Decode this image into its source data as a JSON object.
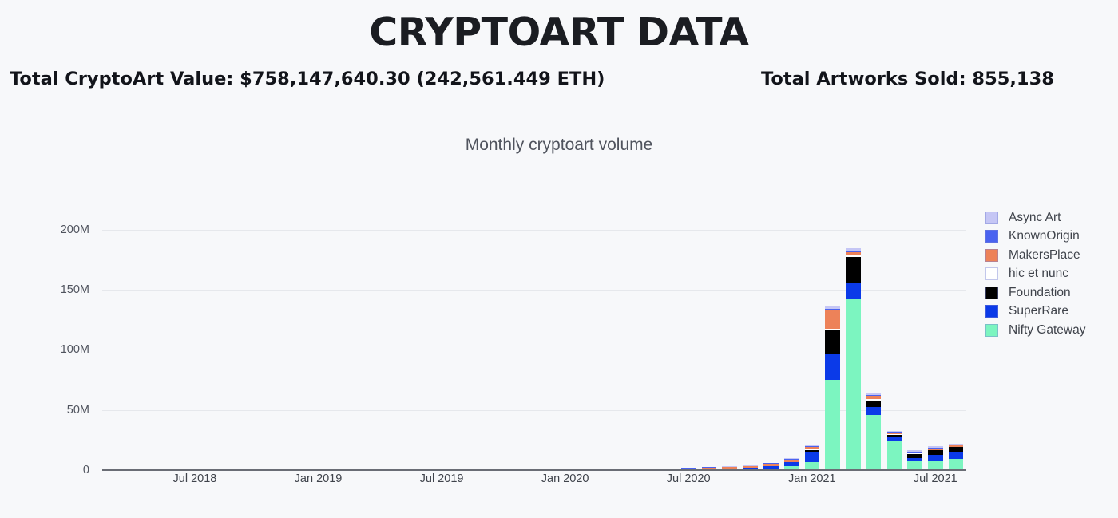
{
  "header": {
    "title": "CRYPTOART DATA",
    "total_value_label": "Total CryptoArt Value: $758,147,640.30 (242,561.449 ETH)",
    "total_sold_label": "Total Artworks Sold: 855,138"
  },
  "chart_data": {
    "type": "bar",
    "stacked": true,
    "title": "Monthly cryptoart volume",
    "xlabel": "",
    "ylabel": "",
    "ylim": [
      0,
      215000000
    ],
    "grid": true,
    "legend_position": "right",
    "ytick_labels": [
      "0",
      "50M",
      "100M",
      "150M",
      "200M"
    ],
    "ytick_values": [
      0,
      50000000,
      100000000,
      150000000,
      200000000
    ],
    "xtick_labels": [
      "Jul 2018",
      "Jan 2019",
      "Jul 2019",
      "Jan 2020",
      "Jul 2020",
      "Jan 2021",
      "Jul 2021"
    ],
    "xtick_indices": [
      4,
      10,
      16,
      22,
      28,
      34,
      40
    ],
    "categories": [
      "Mar 2018",
      "Apr 2018",
      "May 2018",
      "Jun 2018",
      "Jul 2018",
      "Aug 2018",
      "Sep 2018",
      "Oct 2018",
      "Nov 2018",
      "Dec 2018",
      "Jan 2019",
      "Feb 2019",
      "Mar 2019",
      "Apr 2019",
      "May 2019",
      "Jun 2019",
      "Jul 2019",
      "Aug 2019",
      "Sep 2019",
      "Oct 2019",
      "Nov 2019",
      "Dec 2019",
      "Jan 2020",
      "Feb 2020",
      "Mar 2020",
      "Apr 2020",
      "May 2020",
      "Jun 2020",
      "Jul 2020",
      "Aug 2020",
      "Sep 2020",
      "Oct 2020",
      "Nov 2020",
      "Dec 2020",
      "Jan 2021",
      "Feb 2021",
      "Mar 2021",
      "Apr 2021",
      "May 2021",
      "Jun 2021",
      "Jul 2021",
      "Aug 2021"
    ],
    "series": [
      {
        "name": "Nifty Gateway",
        "color": "#7cf5c0",
        "values": [
          0,
          0,
          0,
          0,
          0,
          0,
          0,
          0,
          0,
          0,
          0,
          0,
          0,
          0,
          0,
          0,
          0,
          0,
          0,
          0,
          0,
          0,
          0,
          0,
          0,
          0,
          0,
          0,
          0,
          0,
          0,
          0,
          900000,
          3600000,
          6800000,
          75000000,
          143000000,
          46000000,
          24000000,
          7000000,
          8000000,
          9000000
        ]
      },
      {
        "name": "SuperRare",
        "color": "#0b3ae8",
        "values": [
          180000,
          160000,
          150000,
          170000,
          200000,
          180000,
          160000,
          150000,
          170000,
          200000,
          220000,
          200000,
          260000,
          250000,
          230000,
          260000,
          300000,
          280000,
          260000,
          300000,
          330000,
          350000,
          420000,
          450000,
          380000,
          420000,
          500000,
          700000,
          900000,
          1200000,
          1400000,
          1900000,
          2600000,
          3200000,
          8500000,
          22000000,
          13000000,
          6500000,
          3500000,
          3000000,
          4500000,
          6500000
        ]
      },
      {
        "name": "Foundation",
        "color": "#000000",
        "values": [
          0,
          0,
          0,
          0,
          0,
          0,
          0,
          0,
          0,
          0,
          0,
          0,
          0,
          0,
          0,
          0,
          0,
          0,
          0,
          0,
          0,
          0,
          0,
          0,
          0,
          0,
          0,
          0,
          0,
          0,
          0,
          0,
          0,
          0,
          1400000,
          19000000,
          21000000,
          5500000,
          1800000,
          3200000,
          3800000,
          3500000
        ]
      },
      {
        "name": "hic et nunc",
        "color": "#ffffff",
        "values": [
          0,
          0,
          0,
          0,
          0,
          0,
          0,
          0,
          0,
          0,
          0,
          0,
          0,
          0,
          0,
          0,
          0,
          0,
          0,
          0,
          0,
          0,
          0,
          0,
          0,
          0,
          0,
          0,
          0,
          0,
          0,
          0,
          0,
          0,
          300000,
          1800000,
          1300000,
          900000,
          700000,
          500000,
          500000,
          400000
        ]
      },
      {
        "name": "MakersPlace",
        "color": "#ed8259",
        "values": [
          0,
          0,
          0,
          0,
          0,
          0,
          0,
          0,
          0,
          120000,
          140000,
          130000,
          200000,
          170000,
          160000,
          180000,
          200000,
          190000,
          170000,
          200000,
          220000,
          240000,
          280000,
          300000,
          260000,
          280000,
          320000,
          420000,
          600000,
          900000,
          1100000,
          1300000,
          1700000,
          2100000,
          2400000,
          15000000,
          2800000,
          2600000,
          1200000,
          1100000,
          1200000,
          900000
        ]
      },
      {
        "name": "KnownOrigin",
        "color": "#4a63f0",
        "values": [
          60000,
          60000,
          60000,
          60000,
          70000,
          60000,
          60000,
          60000,
          70000,
          70000,
          80000,
          80000,
          90000,
          90000,
          80000,
          90000,
          100000,
          100000,
          90000,
          100000,
          110000,
          120000,
          130000,
          140000,
          120000,
          130000,
          150000,
          200000,
          260000,
          320000,
          380000,
          450000,
          560000,
          680000,
          800000,
          1600000,
          1500000,
          1100000,
          700000,
          600000,
          700000,
          700000
        ]
      },
      {
        "name": "Async Art",
        "color": "#c5c6f5",
        "values": [
          0,
          0,
          0,
          0,
          0,
          0,
          0,
          0,
          0,
          0,
          0,
          0,
          0,
          0,
          0,
          0,
          0,
          0,
          0,
          0,
          0,
          0,
          60000,
          70000,
          60000,
          70000,
          90000,
          140000,
          200000,
          280000,
          340000,
          420000,
          520000,
          640000,
          900000,
          2500000,
          2200000,
          1500000,
          900000,
          900000,
          1200000,
          1100000
        ]
      }
    ],
    "legend": [
      {
        "label": "Async Art",
        "color": "#c5c6f5"
      },
      {
        "label": "KnownOrigin",
        "color": "#4a63f0"
      },
      {
        "label": "MakersPlace",
        "color": "#ed8259"
      },
      {
        "label": "hic et nunc",
        "color": "#ffffff"
      },
      {
        "label": "Foundation",
        "color": "#000000"
      },
      {
        "label": "SuperRare",
        "color": "#0b3ae8"
      },
      {
        "label": "Nifty Gateway",
        "color": "#7cf5c0"
      }
    ]
  }
}
